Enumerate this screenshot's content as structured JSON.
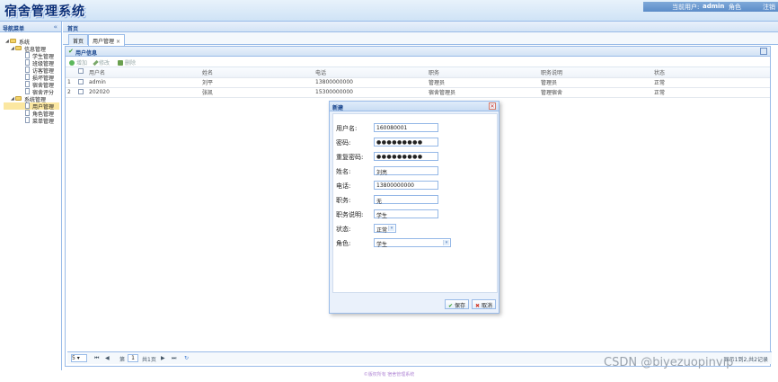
{
  "header": {
    "title": "宿舍管理系统",
    "current_user_label": "当前用户:",
    "current_user": "admin",
    "role_label": "角色",
    "logout": "注销"
  },
  "nav": {
    "title": "导航菜单",
    "collapse_icon": "double-chevron-left-icon",
    "items": [
      {
        "label": "系统",
        "type": "folder"
      },
      {
        "label": "信息管理",
        "type": "folder"
      },
      {
        "label": "学生管理",
        "type": "page"
      },
      {
        "label": "班级管理",
        "type": "page"
      },
      {
        "label": "访客管理",
        "type": "page"
      },
      {
        "label": "损坏管理",
        "type": "page"
      },
      {
        "label": "宿舍管理",
        "type": "page"
      },
      {
        "label": "宿舍评分",
        "type": "page"
      },
      {
        "label": "系统管理",
        "type": "folder"
      },
      {
        "label": "用户管理",
        "type": "page"
      },
      {
        "label": "角色管理",
        "type": "page"
      },
      {
        "label": "菜单管理",
        "type": "page"
      }
    ]
  },
  "main": {
    "title": "首页",
    "tabs": [
      {
        "label": "首页"
      },
      {
        "label": "用户管理",
        "close": "×"
      }
    ],
    "panel_title": "用户信息",
    "toolbar": {
      "add": "增加",
      "edit": "修改",
      "delete": "删除"
    },
    "grid": {
      "columns": [
        "用户名",
        "姓名",
        "电话",
        "职务",
        "职务说明",
        "状态"
      ],
      "rows": [
        {
          "n": "1",
          "username": "admin",
          "name": "刘平",
          "phone": "13800000000",
          "position": "管理员",
          "desc": "管理员",
          "status": "正常"
        },
        {
          "n": "2",
          "username": "202020",
          "name": "张凯",
          "phone": "15300000000",
          "position": "宿舍管理员",
          "desc": "管理宿舍",
          "status": "正常"
        }
      ]
    },
    "pager": {
      "size": "5",
      "page_label": "第",
      "page": "1",
      "total_label": "共1页",
      "right": "显示1到2,共2记录"
    }
  },
  "dialog": {
    "title": "新建",
    "fields": [
      {
        "label": "用户名:",
        "value": "160080001"
      },
      {
        "label": "密码:",
        "value": "●●●●●●●●●"
      },
      {
        "label": "重复密码:",
        "value": "●●●●●●●●●"
      },
      {
        "label": "姓名:",
        "value": "刘亮"
      },
      {
        "label": "电话:",
        "value": "13800000000"
      },
      {
        "label": "职务:",
        "value": "无"
      },
      {
        "label": "职务说明:",
        "value": "学生"
      },
      {
        "label": "状态:",
        "value": "正常"
      },
      {
        "label": "角色:",
        "value": "学生"
      }
    ],
    "save": "保存",
    "cancel": "取消"
  },
  "footer": "©版权所有 宿舍管理系统",
  "watermark": "CSDN @biyezuopinvip",
  "colors": {
    "accent": "#99bbe8",
    "title": "#0a2f78",
    "selected": "#fbe7a1"
  }
}
